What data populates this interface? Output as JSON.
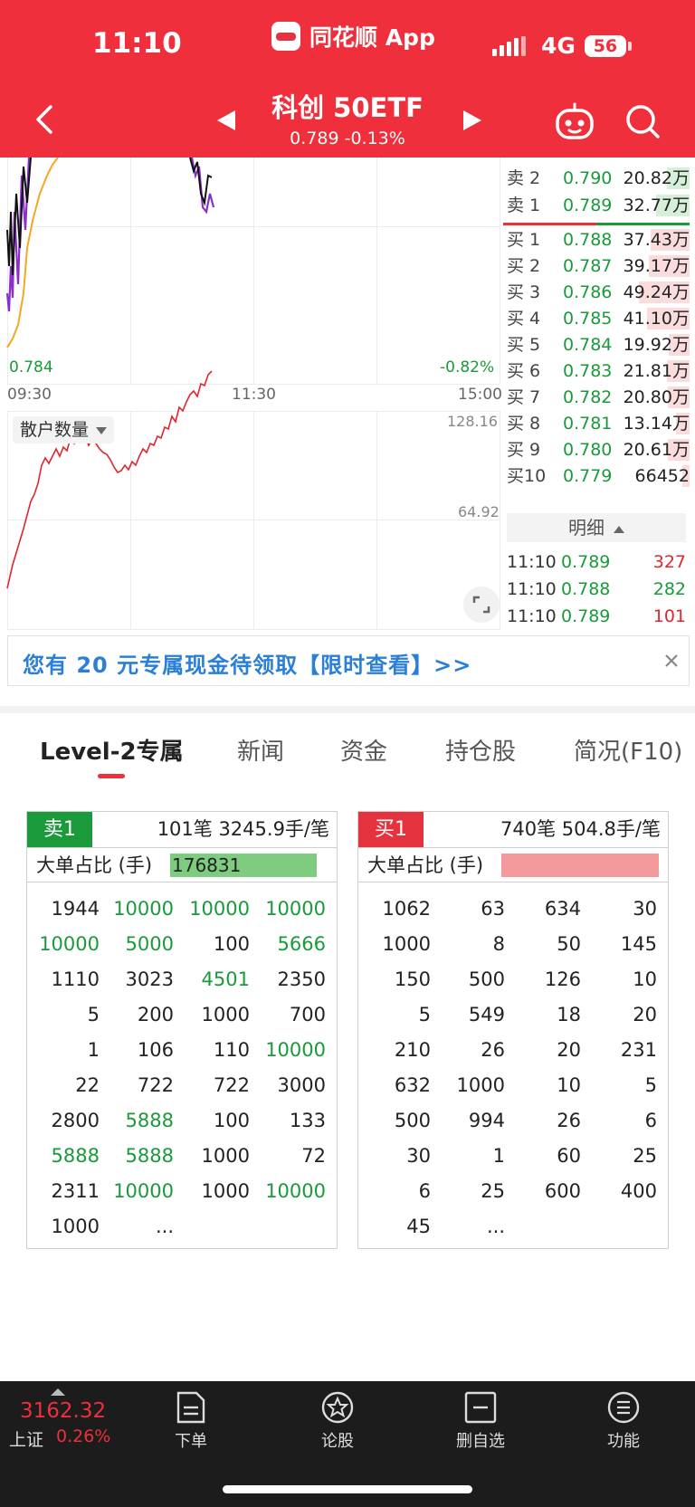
{
  "status_bar": {
    "time": "11:10",
    "app_name": "同花顺 App",
    "network": "4G",
    "battery": "56"
  },
  "header": {
    "title": "科创 50ETF",
    "subtitle": "0.789 -0.13%"
  },
  "chart": {
    "price_low": "0.784",
    "pct_low": "-0.82%",
    "time_labels": [
      "09:30",
      "11:30",
      "15:00"
    ],
    "vol_max": "128.16",
    "vol_mid": "64.92",
    "indicator": "散户数量"
  },
  "order_book": {
    "asks": [
      {
        "label": "卖 2",
        "price": "0.790",
        "volume": "20.82万",
        "level": 0.35
      },
      {
        "label": "卖 1",
        "price": "0.789",
        "volume": "32.77万",
        "level": 0.53
      }
    ],
    "bids": [
      {
        "label": "买 1",
        "price": "0.788",
        "volume": "37.43万",
        "level": 0.61
      },
      {
        "label": "买 2",
        "price": "0.787",
        "volume": "39.17万",
        "level": 0.64
      },
      {
        "label": "买 3",
        "price": "0.786",
        "volume": "49.24万",
        "level": 0.8
      },
      {
        "label": "买 4",
        "price": "0.785",
        "volume": "41.10万",
        "level": 0.67
      },
      {
        "label": "买 5",
        "price": "0.784",
        "volume": "19.92万",
        "level": 0.33
      },
      {
        "label": "买 6",
        "price": "0.783",
        "volume": "21.81万",
        "level": 0.35
      },
      {
        "label": "买 7",
        "price": "0.782",
        "volume": "20.80万",
        "level": 0.34
      },
      {
        "label": "买 8",
        "price": "0.781",
        "volume": "13.14万",
        "level": 0.22
      },
      {
        "label": "买 9",
        "price": "0.780",
        "volume": "20.61万",
        "level": 0.34
      },
      {
        "label": "买10",
        "price": "0.779",
        "volume": "66452",
        "level": 0.11
      }
    ],
    "detail_label": "明细",
    "ticks": [
      {
        "time": "11:10",
        "price": "0.789",
        "volume": "327",
        "color": "#e0262f"
      },
      {
        "time": "11:10",
        "price": "0.788",
        "volume": "282",
        "color": "#1a9a3a"
      },
      {
        "time": "11:10",
        "price": "0.789",
        "volume": "101",
        "color": "#e0262f"
      }
    ]
  },
  "banner": {
    "text": "您有 20 元专属现金待领取【限时查看】>>"
  },
  "tabs": [
    "Level-2专属",
    "新闻",
    "资金",
    "持仓股",
    "简况(F10)"
  ],
  "level2": {
    "sell": {
      "tag": "卖1",
      "info": "101笔   3245.9手/笔",
      "ratio_label": "大单占比 (手)",
      "ratio_value": "176831",
      "ratio_level": 0.93,
      "color": "#1a9a3a",
      "bar_color": "#7dcc80",
      "rows": [
        [
          {
            "v": "1944",
            "g": false
          },
          {
            "v": "10000",
            "g": true
          },
          {
            "v": "10000",
            "g": true
          },
          {
            "v": "10000",
            "g": true
          }
        ],
        [
          {
            "v": "10000",
            "g": true
          },
          {
            "v": "5000",
            "g": true
          },
          {
            "v": "100",
            "g": false
          },
          {
            "v": "5666",
            "g": true
          }
        ],
        [
          {
            "v": "1110",
            "g": false
          },
          {
            "v": "3023",
            "g": false
          },
          {
            "v": "4501",
            "g": true
          },
          {
            "v": "2350",
            "g": false
          }
        ],
        [
          {
            "v": "5",
            "g": false
          },
          {
            "v": "200",
            "g": false
          },
          {
            "v": "1000",
            "g": false
          },
          {
            "v": "700",
            "g": false
          }
        ],
        [
          {
            "v": "1",
            "g": false
          },
          {
            "v": "106",
            "g": false
          },
          {
            "v": "110",
            "g": false
          },
          {
            "v": "10000",
            "g": true
          }
        ],
        [
          {
            "v": "22",
            "g": false
          },
          {
            "v": "722",
            "g": false
          },
          {
            "v": "722",
            "g": false
          },
          {
            "v": "3000",
            "g": false
          }
        ],
        [
          {
            "v": "2800",
            "g": false
          },
          {
            "v": "5888",
            "g": true
          },
          {
            "v": "100",
            "g": false
          },
          {
            "v": "133",
            "g": false
          }
        ],
        [
          {
            "v": "5888",
            "g": true
          },
          {
            "v": "5888",
            "g": true
          },
          {
            "v": "1000",
            "g": false
          },
          {
            "v": "72",
            "g": false
          }
        ],
        [
          {
            "v": "2311",
            "g": false
          },
          {
            "v": "10000",
            "g": true
          },
          {
            "v": "1000",
            "g": false
          },
          {
            "v": "10000",
            "g": true
          }
        ],
        [
          {
            "v": "1000",
            "g": false
          },
          {
            "v": "...",
            "g": false
          }
        ]
      ]
    },
    "buy": {
      "tag": "买1",
      "info": "740笔   504.8手/笔",
      "ratio_label": "大单占比 (手)",
      "ratio_value": "",
      "ratio_level": 1.0,
      "color": "#e5323f",
      "bar_color": "#f3999c",
      "rows": [
        [
          {
            "v": "1062",
            "g": false
          },
          {
            "v": "63",
            "g": false
          },
          {
            "v": "634",
            "g": false
          },
          {
            "v": "30",
            "g": false
          }
        ],
        [
          {
            "v": "1000",
            "g": false
          },
          {
            "v": "8",
            "g": false
          },
          {
            "v": "50",
            "g": false
          },
          {
            "v": "145",
            "g": false
          }
        ],
        [
          {
            "v": "150",
            "g": false
          },
          {
            "v": "500",
            "g": false
          },
          {
            "v": "126",
            "g": false
          },
          {
            "v": "10",
            "g": false
          }
        ],
        [
          {
            "v": "5",
            "g": false
          },
          {
            "v": "549",
            "g": false
          },
          {
            "v": "18",
            "g": false
          },
          {
            "v": "20",
            "g": false
          }
        ],
        [
          {
            "v": "210",
            "g": false
          },
          {
            "v": "26",
            "g": false
          },
          {
            "v": "20",
            "g": false
          },
          {
            "v": "231",
            "g": false
          }
        ],
        [
          {
            "v": "632",
            "g": false
          },
          {
            "v": "1000",
            "g": false
          },
          {
            "v": "10",
            "g": false
          },
          {
            "v": "5",
            "g": false
          }
        ],
        [
          {
            "v": "500",
            "g": false
          },
          {
            "v": "994",
            "g": false
          },
          {
            "v": "26",
            "g": false
          },
          {
            "v": "6",
            "g": false
          }
        ],
        [
          {
            "v": "30",
            "g": false
          },
          {
            "v": "1",
            "g": false
          },
          {
            "v": "60",
            "g": false
          },
          {
            "v": "25",
            "g": false
          }
        ],
        [
          {
            "v": "6",
            "g": false
          },
          {
            "v": "25",
            "g": false
          },
          {
            "v": "600",
            "g": false
          },
          {
            "v": "400",
            "g": false
          }
        ],
        [
          {
            "v": "45",
            "g": false
          },
          {
            "v": "...",
            "g": false
          }
        ]
      ]
    }
  },
  "bottom_bar": {
    "index_value": "3162.32",
    "index_name": "上证",
    "index_pct": "0.26%",
    "nav": [
      {
        "label": "下单",
        "icon": "document-icon"
      },
      {
        "label": "论股",
        "icon": "star-badge-icon"
      },
      {
        "label": "删自选",
        "icon": "minus-box-icon"
      },
      {
        "label": "功能",
        "icon": "menu-circle-icon"
      }
    ]
  }
}
